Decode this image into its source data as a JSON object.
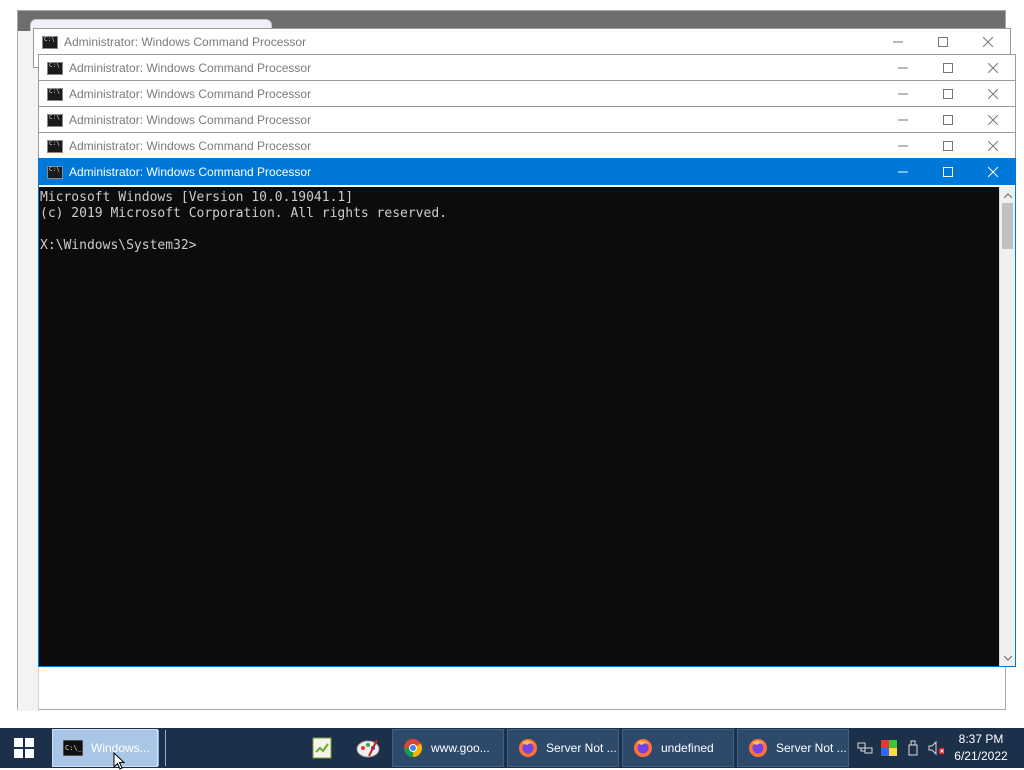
{
  "windows": [
    {
      "title": "Administrator: Windows Command Processor",
      "active": false
    },
    {
      "title": "Administrator: Windows Command Processor",
      "active": false
    },
    {
      "title": "Administrator: Windows Command Processor",
      "active": false
    },
    {
      "title": "Administrator: Windows Command Processor",
      "active": false
    },
    {
      "title": "Administrator: Windows Command Processor",
      "active": false
    },
    {
      "title": "Administrator: Windows Command Processor",
      "active": true
    }
  ],
  "console": {
    "lines": [
      "Microsoft Windows [Version 10.0.19041.1]",
      "(c) 2019 Microsoft Corporation. All rights reserved.",
      "",
      "X:\\Windows\\System32>"
    ]
  },
  "taskbar": {
    "buttons": [
      {
        "label": "Windows...",
        "icon": "cmd-icon"
      },
      {
        "label": "www.goo...",
        "icon": "chrome-icon"
      },
      {
        "label": "Server Not ...",
        "icon": "firefox-icon"
      },
      {
        "label": "undefined",
        "icon": "firefox-icon"
      },
      {
        "label": "Server Not ...",
        "icon": "firefox-icon"
      }
    ],
    "clock": {
      "time": "8:37 PM",
      "date": "6/21/2022"
    }
  },
  "colors": {
    "active_titlebar": "#0078d7",
    "console_bg": "#0c0c0c",
    "console_text": "#cccccc",
    "taskbar": "#1c3049"
  }
}
